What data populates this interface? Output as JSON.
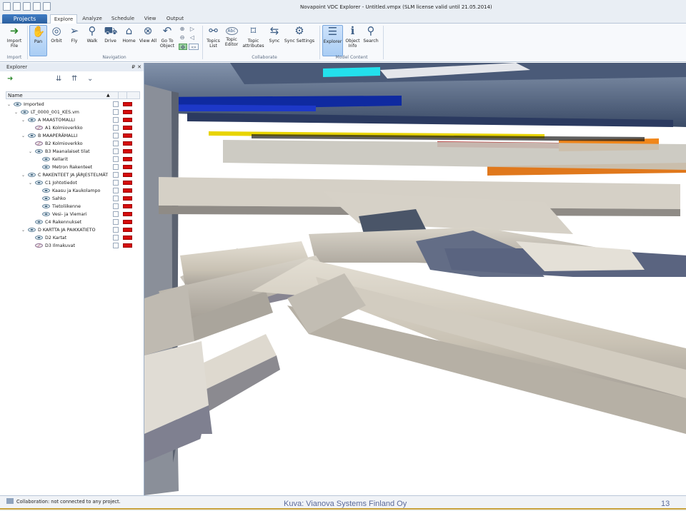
{
  "window": {
    "title": "Novapoint VDC Explorer - Untitled.vmpx (SLM license valid until 21.05.2014)"
  },
  "tabs": [
    {
      "label": "Projects"
    },
    {
      "label": "Explore"
    },
    {
      "label": "Analyze"
    },
    {
      "label": "Schedule"
    },
    {
      "label": "View"
    },
    {
      "label": "Output"
    }
  ],
  "ribbon": {
    "import_file": "Import File",
    "import_group": "Import",
    "pan": "Pan",
    "orbit": "Orbit",
    "fly": "Fly",
    "walk": "Walk",
    "drive": "Drive",
    "home": "Home",
    "view_all": "View All",
    "go_to_object": "Go To Object",
    "navigation_group": "Navigation",
    "topics_list": "Topics List",
    "topic_editor": "Topic Editor",
    "topic_attributes": "Topic attributes",
    "sync": "Sync",
    "sync_settings": "Sync Settings",
    "collaborate_group": "Collaborate",
    "explorer": "Explorer",
    "object_info": "Object Info",
    "search": "Search",
    "model_content_group": "Model Content",
    "topic_editor_badge": "Abc"
  },
  "explorer_panel": {
    "title": "Explorer",
    "pin": "₽",
    "close": "✕",
    "column_name": "Name",
    "tree": [
      {
        "label": "Imported",
        "visible": true
      },
      {
        "label": "LT_0000_001_KES.vm",
        "visible": true
      },
      {
        "label": "A MAASTOMALLI",
        "visible": true
      },
      {
        "label": "A1 Kolmioverkko",
        "visible": false
      },
      {
        "label": "B MAAPERÄMALLI",
        "visible": true
      },
      {
        "label": "B2 Kolmioverkko",
        "visible": false
      },
      {
        "label": "B3 Maanalaiset tilat",
        "visible": true
      },
      {
        "label": "Kellarit",
        "visible": true
      },
      {
        "label": "Metron Rakenteet",
        "visible": true
      },
      {
        "label": "C RAKENTEET JA JÄRJESTELMÄT",
        "visible": true
      },
      {
        "label": "C1 Johtotiedot",
        "visible": true
      },
      {
        "label": "Kaasu ja Kaukolampo",
        "visible": true
      },
      {
        "label": "Sahko",
        "visible": true
      },
      {
        "label": "Tietoliikenne",
        "visible": true
      },
      {
        "label": "Vesi- ja Viemari",
        "visible": true
      },
      {
        "label": "C4 Rakennukset",
        "visible": true
      },
      {
        "label": "D KARTTA JA PAIKKATIETO",
        "visible": true
      },
      {
        "label": "D2 Kartat",
        "visible": true
      },
      {
        "label": "D3 Ilmakuvat",
        "visible": false
      }
    ],
    "layer_color": "#d50b0b"
  },
  "status": {
    "message": "Collaboration: not connected to any project.",
    "credit": "Kuva: Vianova Systems Finland Oy",
    "page": "13"
  }
}
